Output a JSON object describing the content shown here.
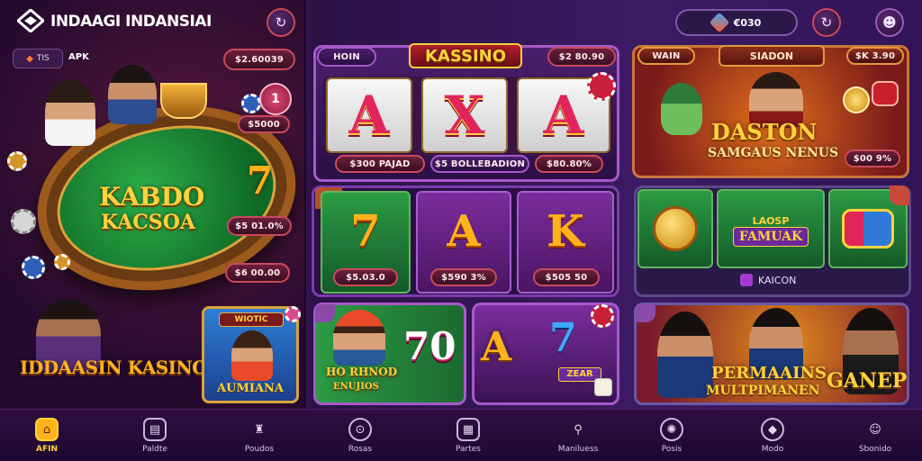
{
  "header": {
    "app_title": "INDAAGI INDANSIAI",
    "apk_label": "APK",
    "left_balance": "$2.60039",
    "right_balance": "€030",
    "logo_icon": "diamond-logo-icon"
  },
  "left": {
    "poker_title_line1": "KABDO",
    "poker_title_line2": "KACSOA",
    "amount_top": "$5000",
    "amount_mid": "$5 01.0%",
    "amount_bot": "$6 00.00",
    "bottom_brand": "IDDAASIN KASINO",
    "card_label": "AUMIANA",
    "card_ribbon": "WIOTIC"
  },
  "slot_panel": {
    "tab_left": "HOIN",
    "title": "KASSINO",
    "tab_right": "$2 80.90",
    "reels": [
      "A",
      "X",
      "A"
    ],
    "footer_left": "$300 PAJAD",
    "footer_mid": "$5 BOLLEBADION",
    "footer_right": "$80.80%"
  },
  "promo_panel": {
    "tab_left": "WAIN",
    "title": "SIADON",
    "tab_right": "$K 3.90",
    "headline_1": "DASTON",
    "headline_2": "SAMGAUS NENUS",
    "amount": "$00 9%"
  },
  "mid_tiles": [
    {
      "symbol": "7",
      "price": "$5.03.0"
    },
    {
      "symbol": "A",
      "price": "$590 3%"
    },
    {
      "symbol": "K",
      "price": "$505 50"
    }
  ],
  "right_tiles": {
    "label": "FAMUAK",
    "sublabel": "LAOSP",
    "footer": "KAICON"
  },
  "bottom_row": {
    "card1_title": "HO RHNOD",
    "card1_sub": "ENUJIOS",
    "card1_symbol": "70",
    "card2_symbols": [
      "A",
      "7"
    ],
    "card2_label": "ZEAR",
    "card3_line1": "PERMAAINS",
    "card3_line2": "MULTPIMANEN",
    "card3_line3": "GANEP"
  },
  "nav": [
    {
      "label": "AFIN",
      "icon": "home-icon"
    },
    {
      "label": "Paldte",
      "icon": "wallet-icon"
    },
    {
      "label": "Poudos",
      "icon": "trophy-icon"
    },
    {
      "label": "Rosas",
      "icon": "gear-icon"
    },
    {
      "label": "Partes",
      "icon": "grid-icon"
    },
    {
      "label": "Maniluess",
      "icon": "search-icon"
    },
    {
      "label": "Posis",
      "icon": "settings-icon"
    },
    {
      "label": "Modo",
      "icon": "diamond-icon"
    },
    {
      "label": "Sbonido",
      "icon": "profile-icon"
    }
  ],
  "colors": {
    "accent_gold": "#ffd23b",
    "accent_red": "#e0255a",
    "panel_purple": "#4a1f6e",
    "felt_green": "#1f8a3a"
  }
}
